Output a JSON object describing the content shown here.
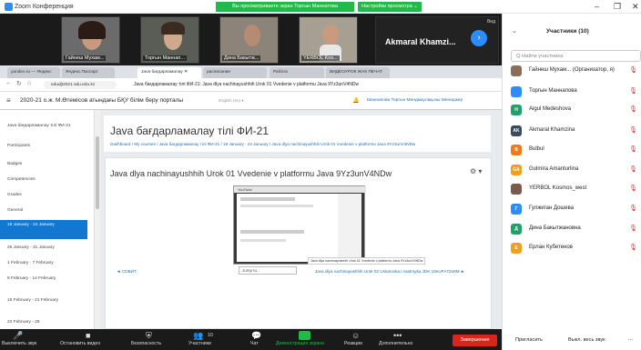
{
  "window": {
    "title": "Zoom Конференция",
    "share_banner": "Вы просматриваете экран Торгын Маннатова",
    "view_options": "Настройки просмотра ⌄",
    "minimize": "–",
    "restore": "❐",
    "close": "✕"
  },
  "videos": [
    {
      "name": "Гайнеш Мухам..."
    },
    {
      "name": "Торгын Маннап..."
    },
    {
      "name": "Дина Бакытж..."
    },
    {
      "name": "YERBOL Kos..."
    },
    {
      "name": "Akmaral  Khamzi..."
    }
  ],
  "video_view_label": "Вид",
  "browser": {
    "tabs": [
      "yandex.ru — Яндекс",
      "Яндекс.Паспорт",
      "Java бағдарламалау ✕",
      "расписание",
      "Работа",
      "ВИДЕОУРОК ЖАК ПЕЧАТ"
    ],
    "url": "edudjt2021.sdu.edu.kz",
    "page_title": "Java бағдарламалау тілі ФИ-21: Java dlya nachinayushhih Urok 01 Vvedenie v platformu Java 9Yz3unV4NDw"
  },
  "moodle": {
    "brand": "2020-21 о.ж. М.Өтемісов атындағы БҚУ білім беру порталы",
    "lang": "English (en) ▾",
    "user": "Маннапова Торгын Миндмаулақызы Менеджер",
    "sidebar": [
      "Java бағдарламалау тілі ФИ-21",
      "Participants",
      "Badges",
      "Competencies",
      "Grades",
      "General",
      "18 January - 24 January",
      "25 January - 31 January",
      "1 February - 7 February",
      "8 February - 14 February",
      "15 February - 21 February",
      "22 February - 28"
    ],
    "course_title": "Java бағдарламалау тілі ФИ-21",
    "breadcrumbs": "Dashboard / My courses / Java бағдарламалау тілі ФИ-21 / 18 January - 24 January / Java dlya nachinayushhih Urok 01 Vvedenie v platformu Java 9Yz3unV4NDw",
    "lesson_title": "Java dlya nachinayushhih Urok 01 Vvedenie v platformu Java 9Yz3unV4NDw",
    "thumb_header": "YouTube",
    "thumb_caption": "Java dlya nachinayushhih Urok 01 Vvedenie v platformu Java 9Yz3unV4NDw",
    "prev_link": "◄ СОВИТ",
    "jump_placeholder": "Jump to...",
    "next_link": "Java dlya nachinayushhih Urok 02 Ustanovka i nastroyka JDK 10eUFA7Zo9M ►"
  },
  "toolbar": {
    "items": [
      "Выключить звук",
      "Остановить видео",
      "Безопасность",
      "Участники",
      "Чат",
      "Демонстрация экрана",
      "Реакции",
      "Дополнительно"
    ],
    "participants_count": "10",
    "end": "Завершение"
  },
  "panel": {
    "title": "Участники (10)",
    "search_placeholder": "Q Найти участника",
    "participants": [
      {
        "name": "Гайнеш Мухам... (Организатор, я)",
        "initials": "",
        "color": "#8a6e5a"
      },
      {
        "name": "Торгын Маннапова",
        "initials": "",
        "color": "#2d8cff"
      },
      {
        "name": "Aigul Medeshova",
        "initials": "H",
        "color": "#22a06b"
      },
      {
        "name": "Akmaral Khamzina",
        "initials": "AK",
        "color": "#3b4a5c"
      },
      {
        "name": "Bulbul",
        "initials": "B",
        "color": "#f07a1a"
      },
      {
        "name": "Gulmira Amanturlina",
        "initials": "GA",
        "color": "#f0a01a"
      },
      {
        "name": "YERBOL Kosmos_west",
        "initials": "",
        "color": "#7a5a4a"
      },
      {
        "name": "Гулжиган Дошева",
        "initials": "Г",
        "color": "#2d8cff"
      },
      {
        "name": "Дина Бакытжановна",
        "initials": "Д",
        "color": "#22a06b"
      },
      {
        "name": "Ерлан Кубетенов",
        "initials": "E",
        "color": "#f0a01a"
      }
    ],
    "invite": "Пригласить",
    "mute_all": "Выкл. весь звук",
    "more": "..."
  }
}
